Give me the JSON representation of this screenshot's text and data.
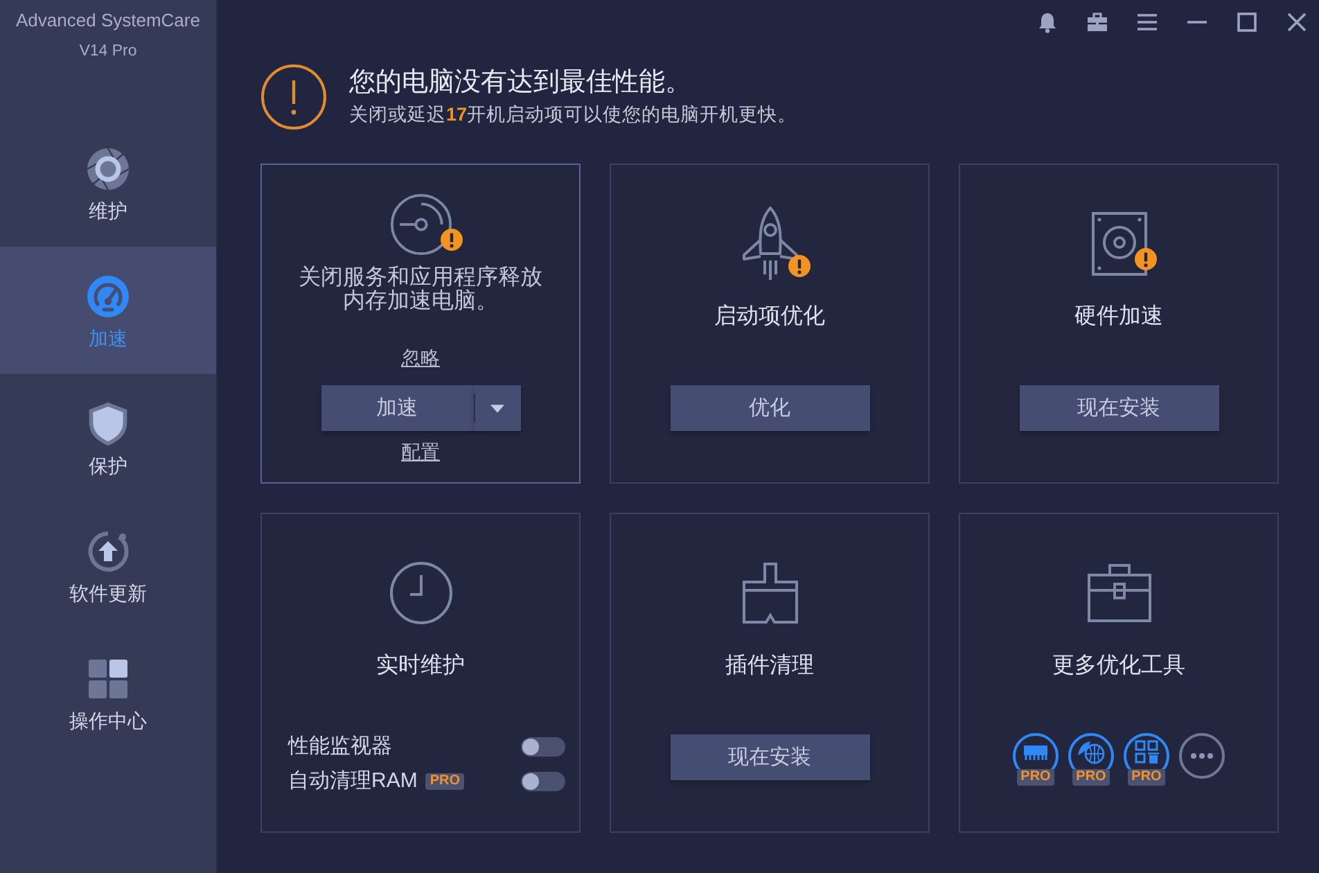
{
  "app": {
    "name": "Advanced SystemCare",
    "version": "V14 Pro"
  },
  "sidebar": {
    "items": [
      {
        "label": "维护",
        "selected": false
      },
      {
        "label": "加速",
        "selected": true
      },
      {
        "label": "保护",
        "selected": false
      },
      {
        "label": "软件更新",
        "selected": false
      },
      {
        "label": "操作中心",
        "selected": false
      }
    ]
  },
  "alert": {
    "title": "您的电脑没有达到最佳性能。",
    "message": "关闭或延迟**17**开机启动项可以使您的电脑开机更快。"
  },
  "cards": [
    {
      "kind": "split",
      "highlighted": true,
      "warning": true,
      "description": "关闭服务和应用程序释放内存加速电脑。",
      "ignore_link": "忽略",
      "button": "加速",
      "config_link": "配置"
    },
    {
      "kind": "button",
      "highlighted": false,
      "warning": true,
      "title": "启动项优化",
      "button": "优化"
    },
    {
      "kind": "button",
      "highlighted": false,
      "warning": true,
      "title": "硬件加速",
      "button": "现在安装"
    },
    {
      "kind": "toggles",
      "highlighted": false,
      "warning": false,
      "title": "实时维护",
      "toggles": [
        {
          "label": "性能监视器",
          "on": false
        },
        {
          "label": "自动清理RAM",
          "badge": "PRO",
          "on": false
        }
      ]
    },
    {
      "kind": "button",
      "highlighted": false,
      "warning": false,
      "title": "插件清理",
      "button": "现在安装"
    },
    {
      "kind": "tools",
      "highlighted": false,
      "warning": false,
      "title": "更多优化工具",
      "tools": [
        {
          "kind": "pro",
          "badge": "PRO"
        },
        {
          "kind": "pro",
          "badge": "PRO"
        },
        {
          "kind": "pro",
          "badge": "PRO"
        },
        {
          "kind": "more"
        }
      ]
    }
  ]
}
